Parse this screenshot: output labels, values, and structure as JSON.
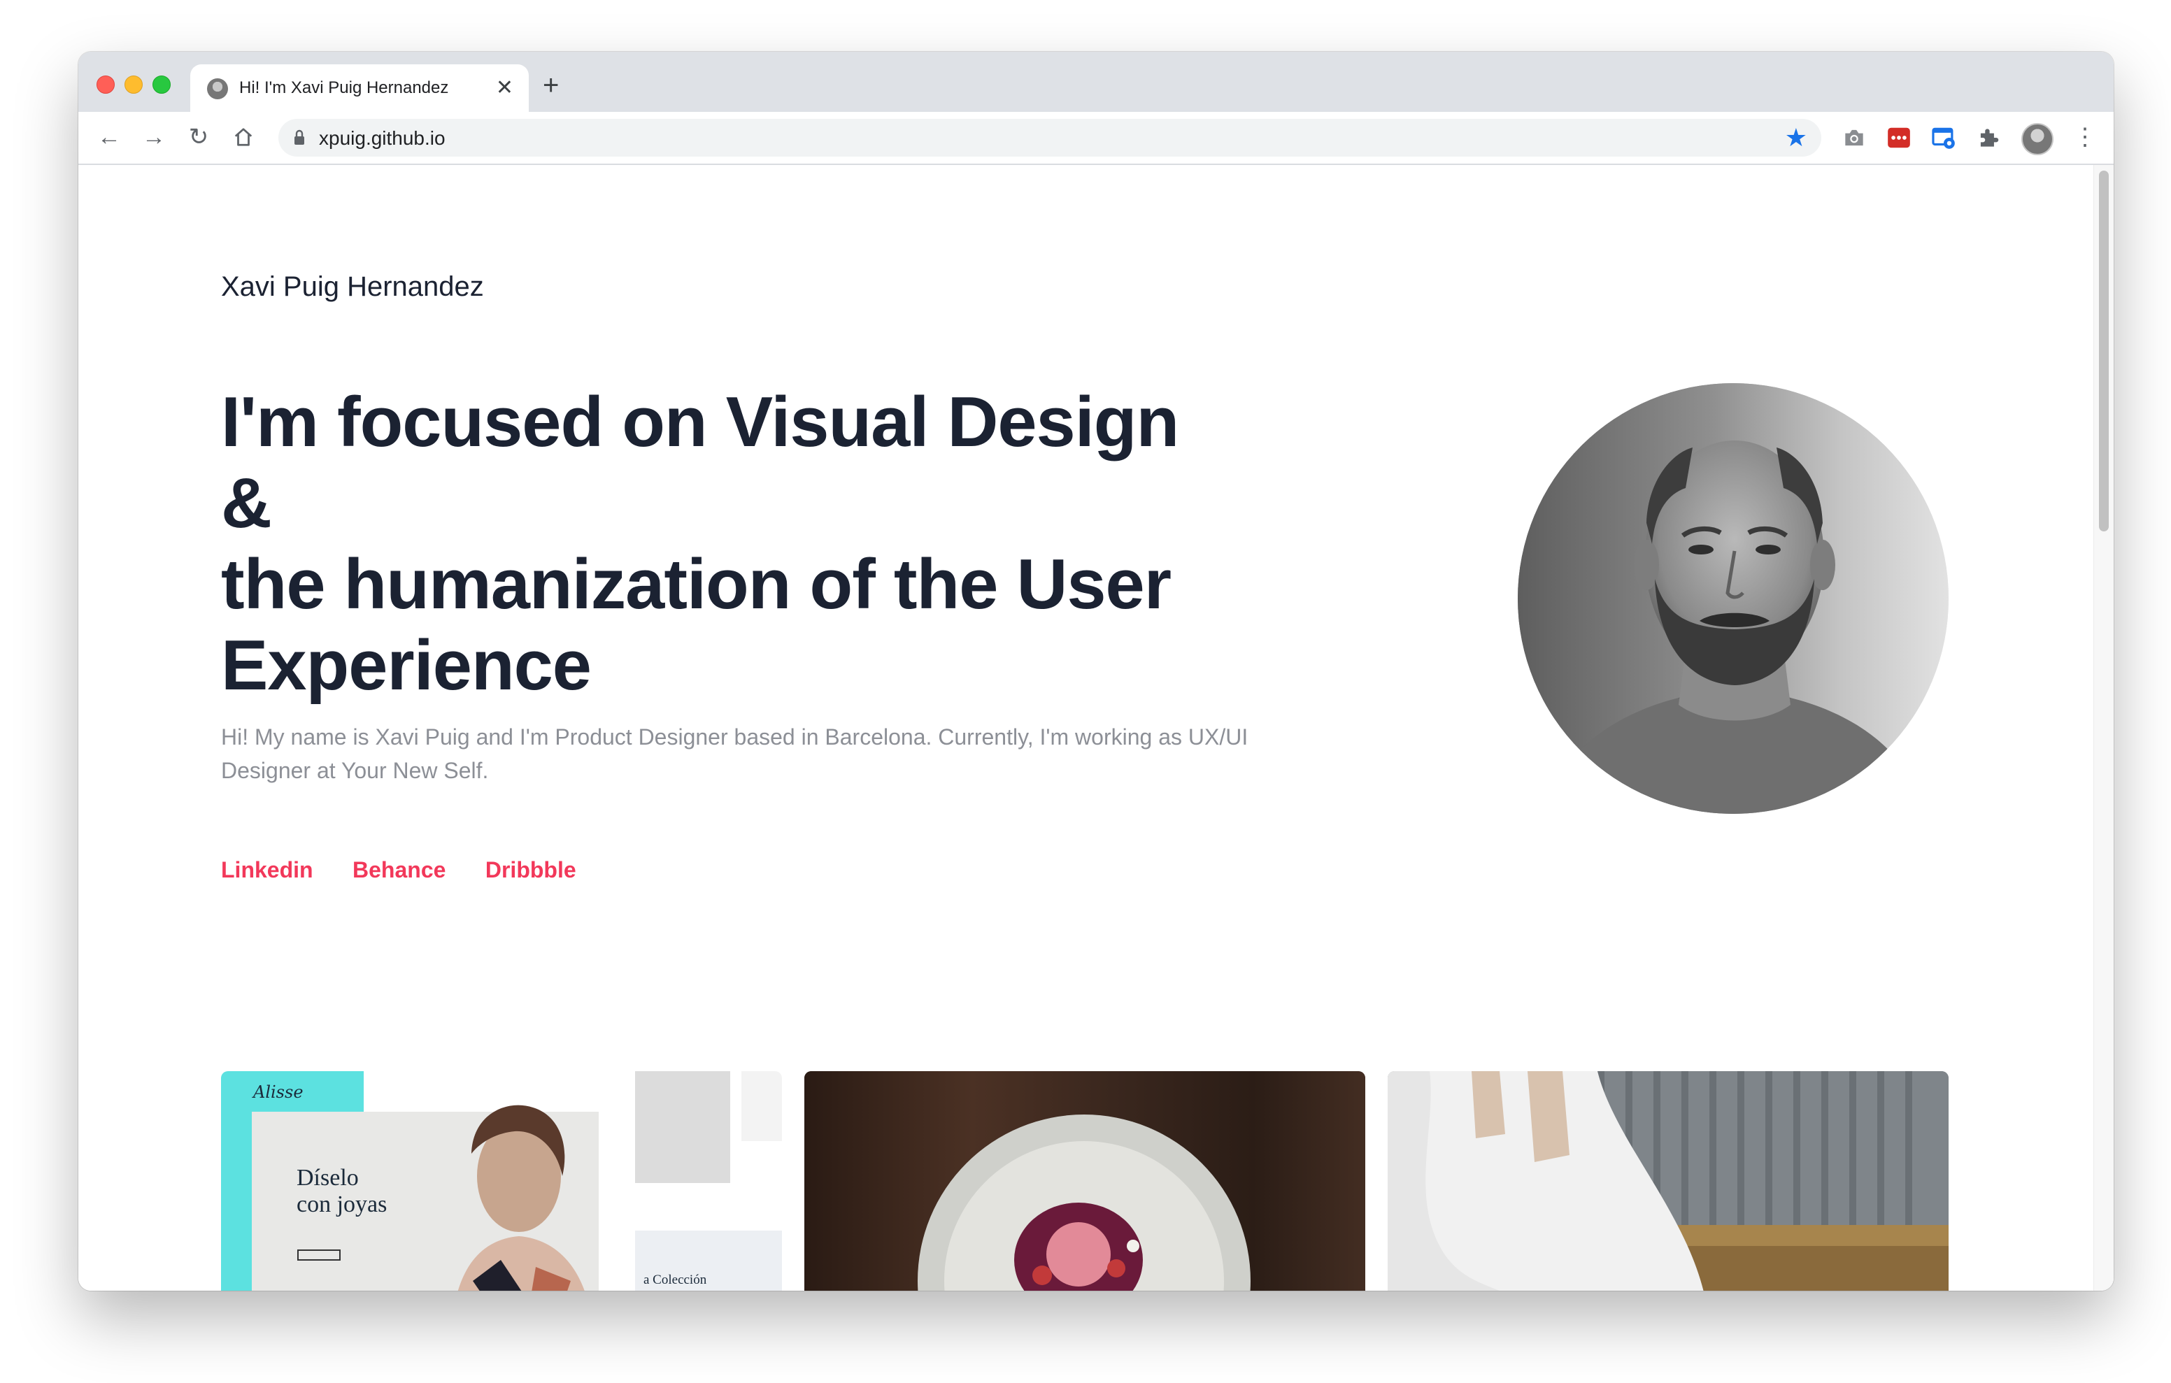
{
  "browser": {
    "tab": {
      "title": "Hi! I'm Xavi Puig Hernandez",
      "close_label": "✕"
    },
    "new_tab_label": "+",
    "url": "xpuig.github.io",
    "bookmarked": true
  },
  "page": {
    "site_name": "Xavi Puig Hernandez",
    "headline_lines": [
      "I'm focused on Visual Design &",
      "the humanization of the User",
      "Experience"
    ],
    "intro": "Hi! My name is Xavi Puig and I'm Product Designer based in Barcelona. Currently, I'm working as UX/UI Designer at Your New Self.",
    "links": [
      "Linkedin",
      "Behance",
      "Dribbble"
    ],
    "accent_color": "#f2385a",
    "heading_color": "#1b2232",
    "text_color": "#8c8f96"
  },
  "portfolio_cards": [
    {
      "kind": "jewelry-website-mockup",
      "brand": "Alisse",
      "heading_lines": [
        "Díselo",
        "con joyas"
      ],
      "secondary_heading": "a Colección"
    },
    {
      "kind": "dessert-plate-photo"
    },
    {
      "kind": "wedding-dress-photo"
    }
  ]
}
